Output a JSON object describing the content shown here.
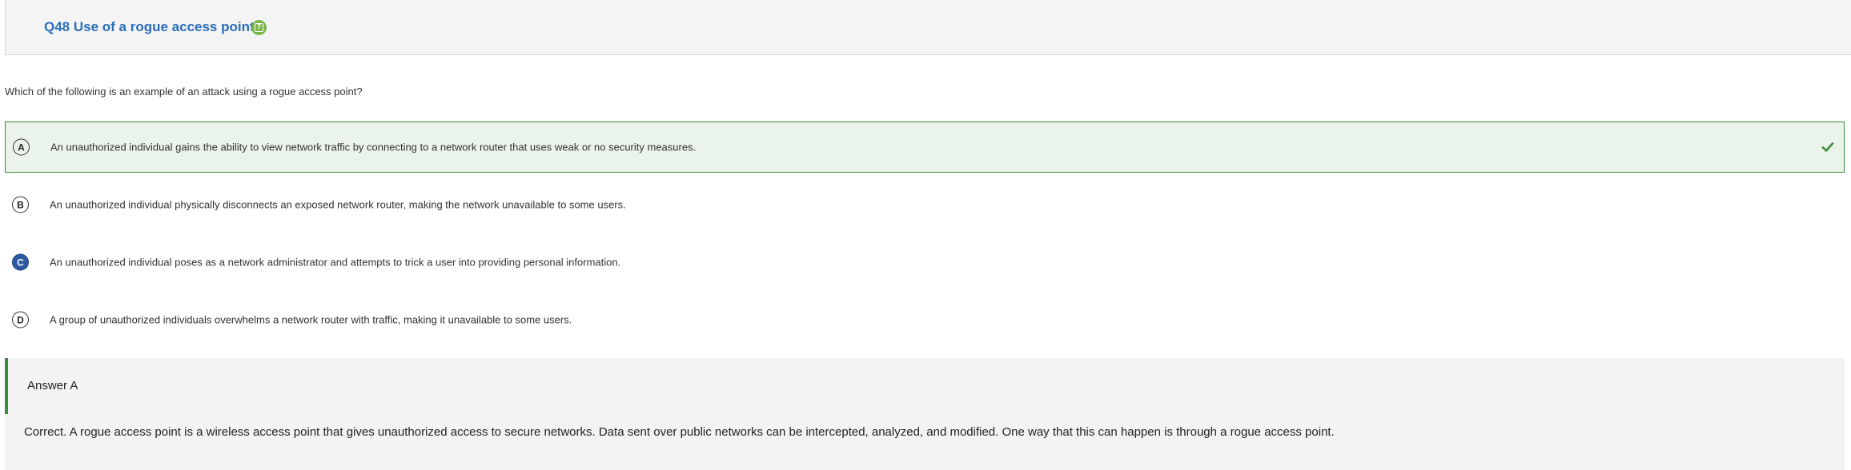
{
  "question": {
    "title": "Q48 Use of a rogue access point",
    "help_icon": "help-icon",
    "prompt": "Which of the following is an example of an attack using a rogue access point?"
  },
  "options": [
    {
      "letter": "A",
      "text": "An unauthorized individual gains the ability to view network traffic by connecting to a network router that uses weak or no security measures.",
      "state": "correct"
    },
    {
      "letter": "B",
      "text": "An unauthorized individual physically disconnects an exposed network router, making the network unavailable to some users.",
      "state": "unselected"
    },
    {
      "letter": "C",
      "text": "An unauthorized individual poses as a network administrator and attempts to trick a user into providing personal information.",
      "state": "selected"
    },
    {
      "letter": "D",
      "text": "A group of unauthorized individuals overwhelms a network router with traffic, making it unavailable to some users.",
      "state": "unselected"
    }
  ],
  "answer": {
    "title": "Answer A",
    "explanation": "Correct. A rogue access point is a wireless access point that gives unauthorized access to secure networks. Data sent over public networks can be intercepted, analyzed, and modified. One way that this can happen is through a rogue access point."
  },
  "colors": {
    "title_blue": "#2a6ebb",
    "help_green": "#7ab648",
    "correct_green": "#3c8a3c",
    "correct_bg": "#eaf4ea",
    "selected_blue": "#2c5aa0"
  }
}
